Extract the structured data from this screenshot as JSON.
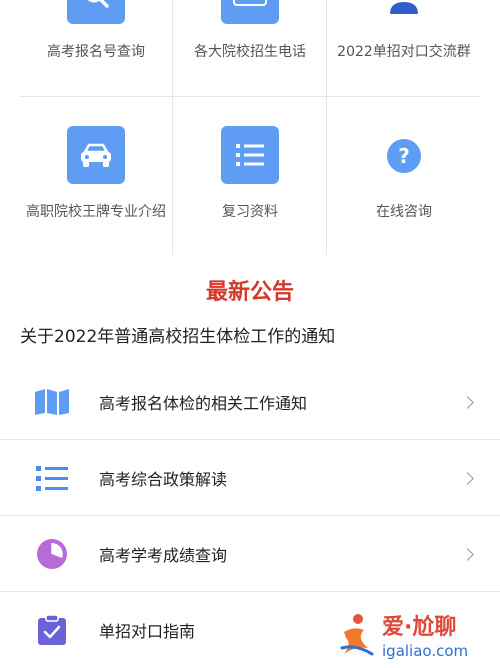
{
  "grid": {
    "items": [
      {
        "label": "高考报名号查询",
        "icon": "search-icon"
      },
      {
        "label": "各大院校招生电话",
        "icon": "phone-keypad-icon"
      },
      {
        "label": "2022单招对口交流群",
        "icon": "user-group-icon"
      },
      {
        "label": "高职院校王牌专业介绍",
        "icon": "car-icon"
      },
      {
        "label": "复习资料",
        "icon": "list-icon"
      },
      {
        "label": "在线咨询",
        "icon": "question-icon"
      }
    ]
  },
  "announcements": {
    "title": "最新公告",
    "notice": "关于2022年普通高校招生体检工作的通知",
    "items": [
      {
        "label": "高考报名体检的相关工作通知",
        "icon": "map-icon"
      },
      {
        "label": "高考综合政策解读",
        "icon": "list-icon"
      },
      {
        "label": "高考学考成绩查询",
        "icon": "pie-chart-icon"
      },
      {
        "label": "单招对口指南",
        "icon": "clipboard-check-icon"
      }
    ]
  },
  "watermark": {
    "brand": "爱·尬聊",
    "url": "igaliao.com"
  },
  "colors": {
    "accent_blue": "#5f9df5",
    "title_red": "#d6392b",
    "pie_purple": "#b86ad9",
    "clipboard_purple": "#6a62d9"
  }
}
